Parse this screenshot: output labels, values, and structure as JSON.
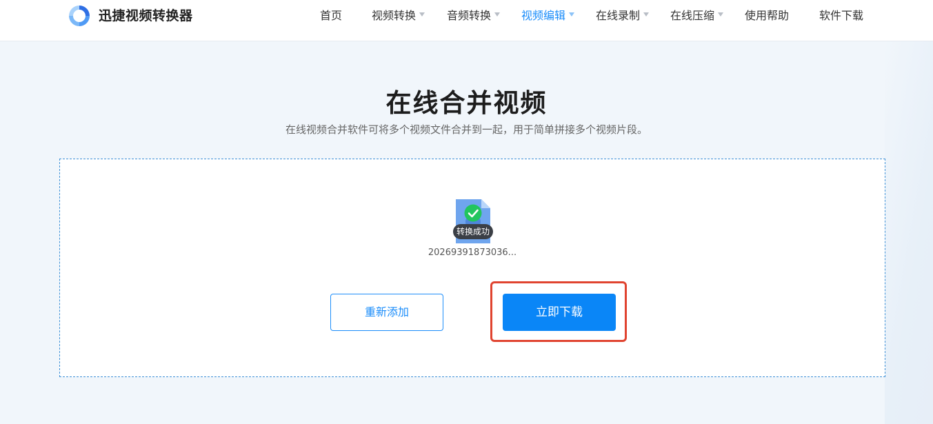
{
  "header": {
    "brand": "迅捷视频转换器",
    "nav": [
      {
        "label": "首页",
        "dropdown": false,
        "active": false
      },
      {
        "label": "视频转换",
        "dropdown": true,
        "active": false
      },
      {
        "label": "音频转换",
        "dropdown": true,
        "active": false
      },
      {
        "label": "视频编辑",
        "dropdown": true,
        "active": true
      },
      {
        "label": "在线录制",
        "dropdown": true,
        "active": false
      },
      {
        "label": "在线压缩",
        "dropdown": true,
        "active": false
      },
      {
        "label": "使用帮助",
        "dropdown": false,
        "active": false
      },
      {
        "label": "软件下载",
        "dropdown": false,
        "active": false
      }
    ]
  },
  "main": {
    "title": "在线合并视频",
    "subtitle": "在线视频合并软件可将多个视频文件合并到一起，用于简单拼接多个视频片段。",
    "file": {
      "status": "转换成功",
      "name": "20269391873036..."
    },
    "buttons": {
      "readd": "重新添加",
      "download": "立即下载"
    }
  },
  "colors": {
    "accent": "#1a8cfa",
    "download_button": "#0a86f7",
    "highlight": "#e0432f",
    "success": "#22c55e"
  },
  "icons": {
    "logo": "brand-logo-icon",
    "file": "video-file-icon",
    "check": "check-circle-icon",
    "dropdown": "caret-down-icon"
  }
}
